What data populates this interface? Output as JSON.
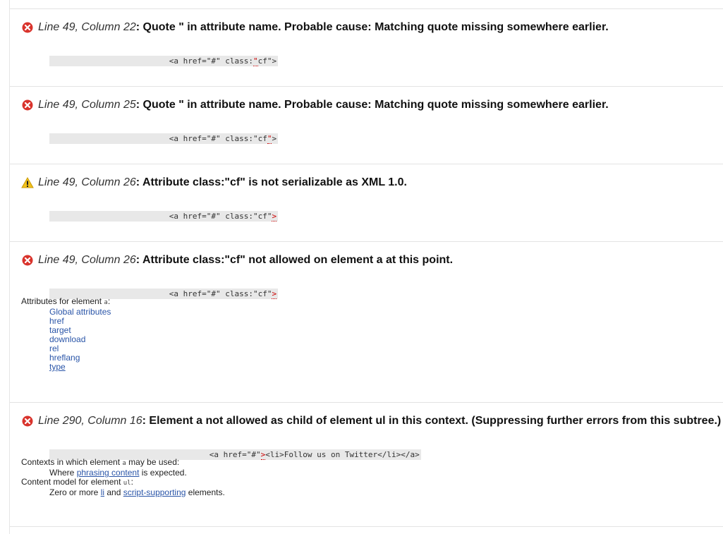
{
  "entries": [
    {
      "location": "Line 49, Column 22",
      "message": ": Quote \" in attribute name. Probable cause: Matching quote missing somewhere earlier.",
      "code_before": "<a href=\"#\" class:",
      "code_mark": "\"",
      "code_after": "cf\">"
    },
    {
      "location": "Line 49, Column 25",
      "message": ": Quote \" in attribute name. Probable cause: Matching quote missing somewhere earlier.",
      "code_before": "<a href=\"#\" class:\"cf",
      "code_mark": "\"",
      "code_after": ">"
    },
    {
      "location": "Line 49, Column 26",
      "message": ": Attribute class:\"cf\" is not serializable as XML 1.0.",
      "code_before": "<a href=\"#\" class:\"cf\"",
      "code_mark": ">",
      "code_after": ""
    },
    {
      "location": "Line 49, Column 26",
      "message": ": Attribute class:\"cf\" not allowed on element a at this point.",
      "code_before": "<a href=\"#\" class:\"cf\"",
      "code_mark": ">",
      "code_after": "",
      "attrs_intro": "Attributes for element ",
      "attrs_code": "a",
      "attrs_colon": ":",
      "attrs": [
        "Global attributes",
        "href",
        "target",
        "download",
        "rel",
        "hreflang",
        "type"
      ]
    },
    {
      "location": "Line 290, Column 16",
      "message": ": Element a not allowed as child of element ul in this context. (Suppressing further errors from this subtree.)",
      "code_before": "<a href=\"#\"",
      "code_mark": ">",
      "code_after": "<li>Follow us on Twitter</li></a>",
      "ctx_intro": "Contexts in which element ",
      "ctx_code": "a",
      "ctx_end": " may be used:",
      "ctx_where": "Where ",
      "ctx_link": "phrasing content",
      "ctx_where_end": " is expected.",
      "model_intro": "Content model for element ",
      "model_code": "ul",
      "model_colon": ":",
      "model_pre": "Zero or more ",
      "model_li": "li",
      "model_and": " and ",
      "model_link": "script-supporting",
      "model_end": " elements."
    }
  ],
  "colors": {
    "error": "#d9332c",
    "warning": "#f2c21b",
    "link": "#2a55a8",
    "mark": "#cc0000"
  },
  "icons": {
    "error": "error-circle-x-icon",
    "warning": "warning-triangle-icon"
  }
}
